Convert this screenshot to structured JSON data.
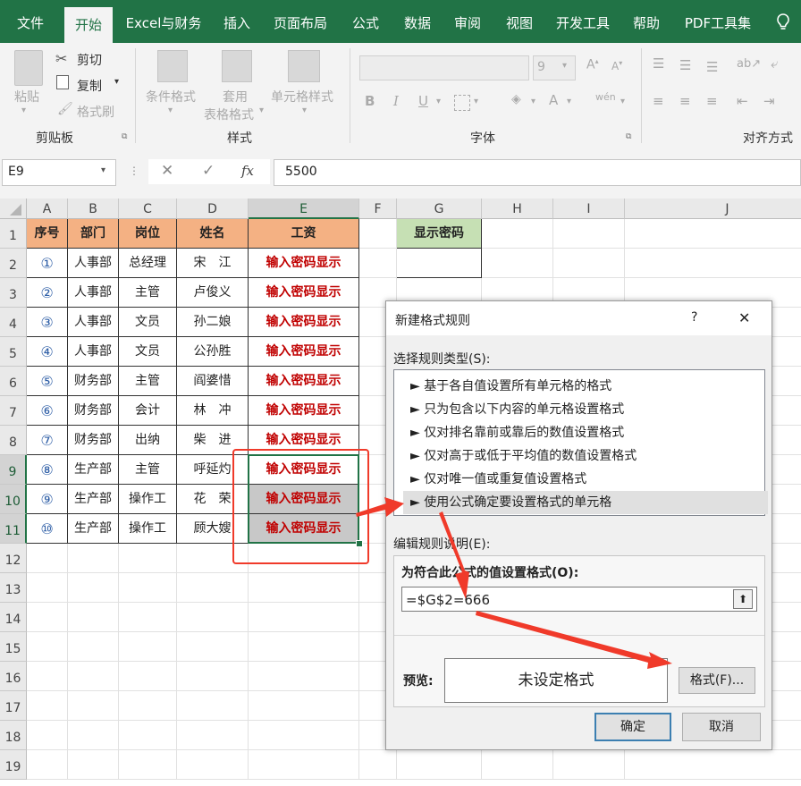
{
  "ribbon": {
    "tabs": [
      "文件",
      "开始",
      "Excel与财务",
      "插入",
      "页面布局",
      "公式",
      "数据",
      "审阅",
      "视图",
      "开发工具",
      "帮助",
      "PDF工具集"
    ],
    "active_tab": "开始",
    "clipboard": {
      "paste": "粘贴",
      "cut": "剪切",
      "copy": "复制",
      "format_painter": "格式刷",
      "group": "剪贴板"
    },
    "styles": {
      "conditional": "条件格式",
      "table_format_1": "套用",
      "table_format_2": "表格格式",
      "cell_styles": "单元格样式",
      "group": "样式"
    },
    "font": {
      "size": "9",
      "group": "字体",
      "bold": "B",
      "italic": "I",
      "underline": "U"
    },
    "alignment": {
      "group": "对齐方式"
    }
  },
  "formula_bar": {
    "name_box": "E9",
    "fx": "fx",
    "value": "5500"
  },
  "sheet": {
    "columns": [
      "A",
      "B",
      "C",
      "D",
      "E",
      "F",
      "G",
      "H",
      "I",
      "J"
    ],
    "rows": [
      "1",
      "2",
      "3",
      "4",
      "5",
      "6",
      "7",
      "8",
      "9",
      "10",
      "11",
      "12",
      "13",
      "14",
      "15",
      "16",
      "17",
      "18",
      "19"
    ],
    "headers": [
      "序号",
      "部门",
      "岗位",
      "姓名",
      "工资"
    ],
    "data": [
      [
        "①",
        "人事部",
        "总经理",
        "宋　江",
        "输入密码显示"
      ],
      [
        "②",
        "人事部",
        "主管",
        "卢俊义",
        "输入密码显示"
      ],
      [
        "③",
        "人事部",
        "文员",
        "孙二娘",
        "输入密码显示"
      ],
      [
        "④",
        "人事部",
        "文员",
        "公孙胜",
        "输入密码显示"
      ],
      [
        "⑤",
        "财务部",
        "主管",
        "阎婆惜",
        "输入密码显示"
      ],
      [
        "⑥",
        "财务部",
        "会计",
        "林　冲",
        "输入密码显示"
      ],
      [
        "⑦",
        "财务部",
        "出纳",
        "柴　进",
        "输入密码显示"
      ],
      [
        "⑧",
        "生产部",
        "主管",
        "呼延灼",
        "输入密码显示"
      ],
      [
        "⑨",
        "生产部",
        "操作工",
        "花　荣",
        "输入密码显示"
      ],
      [
        "⑩",
        "生产部",
        "操作工",
        "顾大嫂",
        "输入密码显示"
      ]
    ],
    "g1": "显示密码"
  },
  "dialog": {
    "title": "新建格式规则",
    "help": "?",
    "close": "✕",
    "select_rule_type": "选择规则类型(S):",
    "rule_types": [
      "► 基于各自值设置所有单元格的格式",
      "► 只为包含以下内容的单元格设置格式",
      "► 仅对排名靠前或靠后的数值设置格式",
      "► 仅对高于或低于平均值的数值设置格式",
      "► 仅对唯一值或重复值设置格式",
      "► 使用公式确定要设置格式的单元格"
    ],
    "edit_desc": "编辑规则说明(E):",
    "formula_label": "为符合此公式的值设置格式(O):",
    "formula": "=$G$2=666",
    "preview_label": "预览:",
    "preview_text": "未设定格式",
    "format_button": "格式(F)...",
    "ok": "确定",
    "cancel": "取消"
  },
  "colors": {
    "excel_green": "#217346",
    "header_orange": "#f4b183",
    "header_green": "#c6e0b4",
    "password_red": "#c00000",
    "arrow_red": "#f03a2a"
  }
}
